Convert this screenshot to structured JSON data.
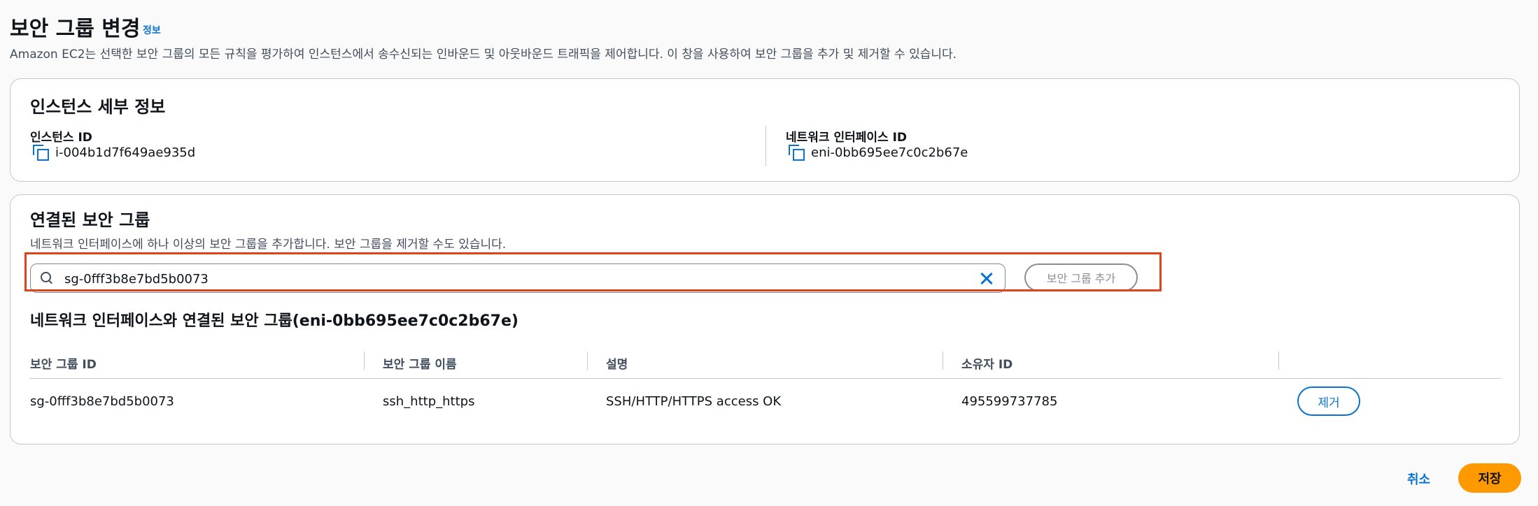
{
  "page": {
    "title": "보안 그룹 변경",
    "info_link": "정보",
    "description": "Amazon EC2는 선택한 보안 그룹의 모든 규칙을 평가하여 인스턴스에서 송수신되는 인바운드 및 아웃바운드 트래픽을 제어합니다. 이 창을 사용하여 보안 그룹을 추가 및 제거할 수 있습니다."
  },
  "instance_details": {
    "heading": "인스턴스 세부 정보",
    "instance_id_label": "인스턴스 ID",
    "instance_id": "i-004b1d7f649ae935d",
    "eni_label": "네트워크 인터페이스 ID",
    "eni_id": "eni-0bb695ee7c0c2b67e"
  },
  "security_groups": {
    "heading": "연결된 보안 그룹",
    "description": "네트워크 인터페이스에 하나 이상의 보안 그룹을 추가합니다. 보안 그룹을 제거할 수도 있습니다.",
    "search_value": "sg-0fff3b8e7bd5b0073",
    "add_button": "보안 그룹 추가",
    "table_heading": "네트워크 인터페이스와 연결된 보안 그룹(eni-0bb695ee7c0c2b67e)",
    "columns": [
      "보안 그룹 ID",
      "보안 그룹 이름",
      "설명",
      "소유자 ID"
    ],
    "rows": [
      {
        "id": "sg-0fff3b8e7bd5b0073",
        "name": "ssh_http_https",
        "description": "SSH/HTTP/HTTPS access OK",
        "owner": "495599737785",
        "remove_label": "제거"
      }
    ]
  },
  "footer": {
    "cancel": "취소",
    "save": "저장"
  },
  "colors": {
    "accent": "#0972d3",
    "primary_button": "#ff9900",
    "highlight": "#e0421b"
  }
}
